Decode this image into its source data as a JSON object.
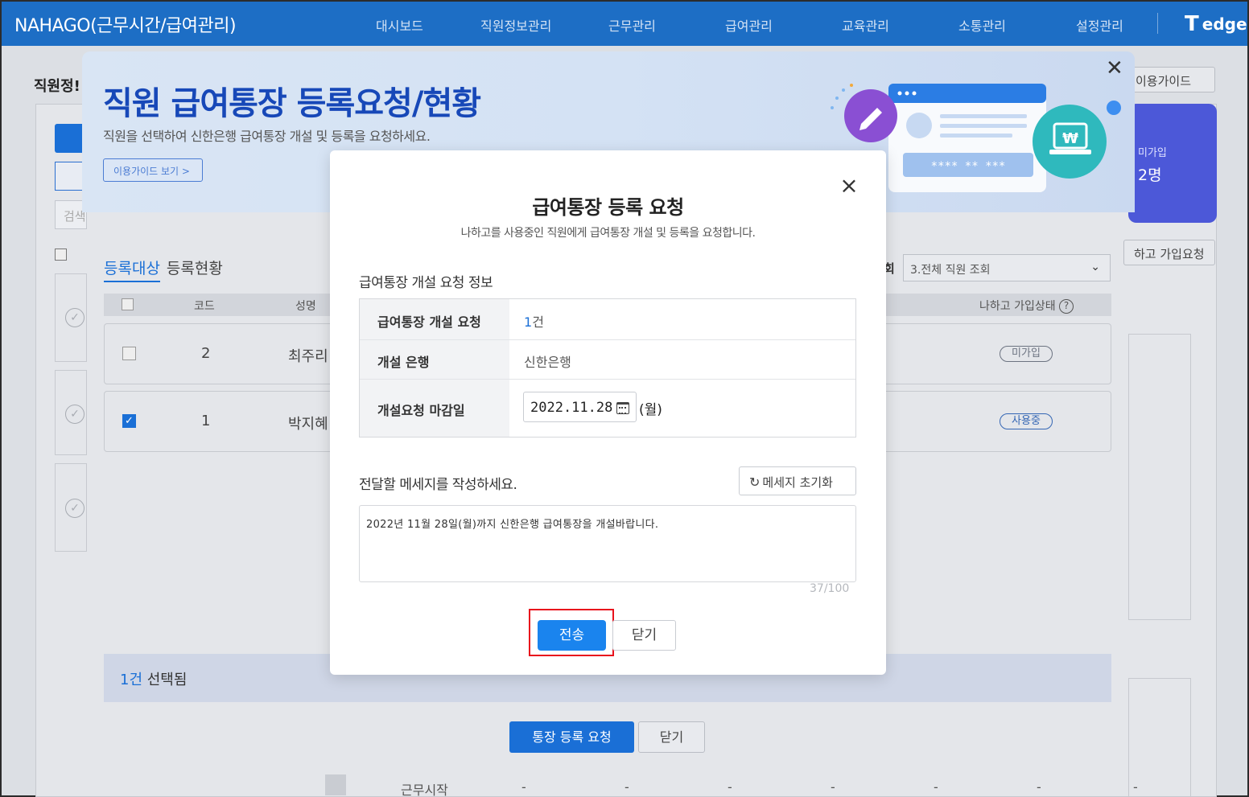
{
  "app": {
    "brand": "NAHAGO(근무시간/급여관리)",
    "nav": [
      "대시보드",
      "직원정보관리",
      "근무관리",
      "급여관리",
      "교육관리",
      "소통관리",
      "설정관리"
    ],
    "partner_logo": "edge",
    "partner_logo_mark": "T"
  },
  "background": {
    "page_title": "직원정!",
    "guide_link": "이용가이드",
    "summary_card": {
      "label": "미가입",
      "value": "2명"
    },
    "nahago_join_button": "하고 가입요청",
    "search_placeholder": "검색",
    "tabs": [
      "등록대상",
      "등록현황"
    ],
    "view_label": "회",
    "view_select": "3.전체 직원 조회",
    "table_headers": [
      "코드",
      "성명",
      "나하고 가입상태"
    ],
    "rows": [
      {
        "code": "2",
        "name": "최주리",
        "status": "미가입",
        "checked": false
      },
      {
        "code": "1",
        "name": "박지혜",
        "status": "사용중",
        "checked": true
      }
    ],
    "selected_count": "1건",
    "selected_suffix": "선택됨",
    "request_button": "통장 등록 요청",
    "close_button": "닫기",
    "bottom_row_label": "근무시작",
    "bottom_dash": "-"
  },
  "guide_overlay": {
    "title": "직원 급여통장 등록요청/현황",
    "subtitle": "직원을 선택하여 신한은행 급여통장 개설 및 등록을 요청하세요.",
    "guide_button": "이용가이드 보기 >",
    "illustration_mask": "**** ** ***",
    "currency_symbol": "₩"
  },
  "modal": {
    "title": "급여통장 등록 요청",
    "subtitle": "나하고를 사용중인 직원에게 급여통장 개설 및 등록을 요청합니다.",
    "section_title": "급여통장 개설 요청 정보",
    "rows": [
      {
        "label": "급여통장 개설 요청",
        "value_num": "1",
        "value_unit": "건"
      },
      {
        "label": "개설 은행",
        "value": "신한은행"
      },
      {
        "label": "개설요청 마감일",
        "date": "2022.11.28",
        "weekday": "(월)"
      }
    ],
    "message_label": "전달할 메세지를 작성하세요.",
    "reset_button": "메세지 초기화",
    "message": "2022년 11월 28일(월)까지 신한은행 급여통장을 개설바랍니다.",
    "char_count": "37/100",
    "send_button": "전송",
    "close_button": "닫기"
  },
  "colors": {
    "brand_blue": "#1d6ec5",
    "primary_button": "#1a84ee",
    "highlight_red": "#e8111c",
    "guide_title_blue": "#1748b8",
    "summary_purple": "#4c58d8"
  }
}
